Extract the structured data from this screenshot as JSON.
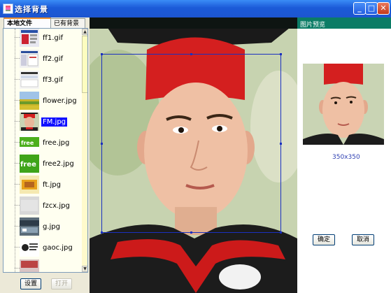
{
  "window": {
    "title": "选择背景",
    "controls": {
      "minimize": "_",
      "maximize": "□",
      "close": "✕"
    }
  },
  "tabs": [
    {
      "label": "本地文件",
      "active": true
    },
    {
      "label": "已有背景",
      "active": false
    }
  ],
  "file_list": {
    "items": [
      {
        "name": "ff1.gif",
        "selected": false,
        "thumb": "ui-screenshot"
      },
      {
        "name": "ff2.gif",
        "selected": false,
        "thumb": "ui-screenshot"
      },
      {
        "name": "ff3.gif",
        "selected": false,
        "thumb": "ui-screenshot"
      },
      {
        "name": "flower.jpg",
        "selected": false,
        "thumb": "field"
      },
      {
        "name": "FM.jpg",
        "selected": true,
        "thumb": "boy-portrait"
      },
      {
        "name": "free.jpg",
        "selected": false,
        "thumb": "free-logo"
      },
      {
        "name": "free2.jpg",
        "selected": false,
        "thumb": "free-logo-big"
      },
      {
        "name": "ft.jpg",
        "selected": false,
        "thumb": "yellow-box"
      },
      {
        "name": "fzcx.jpg",
        "selected": false,
        "thumb": "gray-blank"
      },
      {
        "name": "g.jpg",
        "selected": false,
        "thumb": "dark-banner"
      },
      {
        "name": "gaoc.jpg",
        "selected": false,
        "thumb": "text-doc"
      }
    ]
  },
  "left_buttons": {
    "settings": "设置",
    "open": "打开"
  },
  "preview": {
    "title": "图片预览",
    "size": "350x350"
  },
  "actions": {
    "ok": "确定",
    "cancel": "取消"
  },
  "colors": {
    "titlebar": "#1c56d0",
    "preview_header": "#0b7c66",
    "selection": "#1010ff",
    "size_text": "#2d3fb2"
  }
}
